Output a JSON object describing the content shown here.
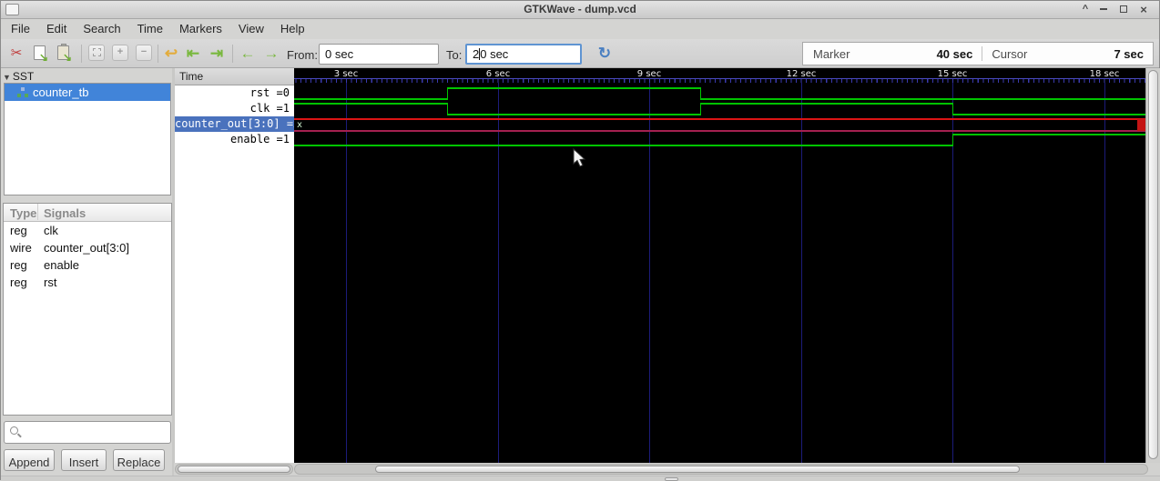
{
  "window": {
    "title": "GTKWave - dump.vcd",
    "controls": {
      "shade": "^",
      "close": "×"
    }
  },
  "menu": {
    "items": [
      "File",
      "Edit",
      "Search",
      "Time",
      "Markers",
      "View",
      "Help"
    ]
  },
  "toolbar": {
    "icons": [
      "cut-icon",
      "copy-icon",
      "paste-icon",
      "zoom-fit-icon",
      "zoom-in-icon",
      "zoom-out-icon",
      "zoom-undo-icon",
      "to-start-icon",
      "to-end-icon",
      "shift-left-icon",
      "shift-right-icon",
      "reload-icon"
    ],
    "glyphs": {
      "cut": "✂",
      "zoom_in": "+",
      "zoom_out": "−",
      "zoom_undo": "↩",
      "to_start": "⇤",
      "to_end": "⇥",
      "shift_left": "←",
      "shift_right": "→",
      "reload": "↻",
      "copy_arrow": "↘",
      "paste_arrow": "↘"
    },
    "from_label": "From:",
    "from_value": "0 sec",
    "to_label": "To:",
    "to_before": "2",
    "to_after": "0 sec",
    "marker_label": "Marker",
    "marker_value": "40 sec",
    "cursor_label": "Cursor",
    "cursor_value": "7 sec"
  },
  "sst": {
    "header": "SST",
    "collapse_glyph": "▼",
    "tree": [
      {
        "label": "counter_tb",
        "selected": true
      }
    ]
  },
  "signals_table": {
    "columns": [
      "Type",
      "Signals"
    ],
    "rows": [
      {
        "type": "reg",
        "signal": "clk"
      },
      {
        "type": "wire",
        "signal": "counter_out[3:0]"
      },
      {
        "type": "reg",
        "signal": "enable"
      },
      {
        "type": "reg",
        "signal": "rst"
      }
    ]
  },
  "search": {
    "value": ""
  },
  "actions": {
    "append": "Append",
    "insert": "Insert",
    "replace": "Replace"
  },
  "names_panel": {
    "header": "Time",
    "rows": [
      {
        "text": "rst =0",
        "selected": false
      },
      {
        "text": "clk =1",
        "selected": false
      },
      {
        "text": "counter_out[3:0] =x",
        "selected": true
      },
      {
        "text": "enable =1",
        "selected": false
      }
    ]
  },
  "chart_data": {
    "type": "waveform",
    "time_unit": "sec",
    "tick_label_suffix": " sec",
    "ticks_sec": [
      3,
      6,
      9,
      12,
      15,
      18
    ],
    "visible_range_sec": [
      2,
      18.8
    ],
    "colors": {
      "bit": "#00c400",
      "bus_top": "#dd1414",
      "bus_bottom": "#a52050",
      "grid": "#1c1c7a",
      "unknown_text": "#d9ffd9"
    },
    "signals": [
      {
        "name": "rst",
        "kind": "bit",
        "initial": 0,
        "edges": [
          {
            "t": 5,
            "v": 1
          },
          {
            "t": 10,
            "v": 0
          }
        ]
      },
      {
        "name": "clk",
        "kind": "bit",
        "initial": 1,
        "edges": [
          {
            "t": 5,
            "v": 0
          },
          {
            "t": 10,
            "v": 1
          },
          {
            "t": 15,
            "v": 0
          }
        ]
      },
      {
        "name": "counter_out[3:0]",
        "kind": "bus",
        "value": "x"
      },
      {
        "name": "enable",
        "kind": "bit",
        "initial": 0,
        "edges": [
          {
            "t": 15,
            "v": 1
          }
        ]
      }
    ]
  }
}
